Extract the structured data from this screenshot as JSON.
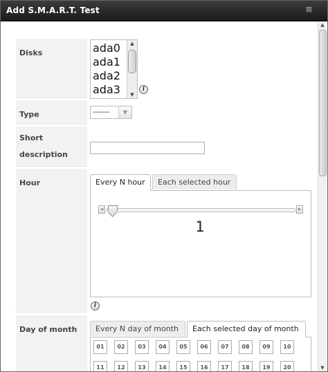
{
  "dialog": {
    "title": "Add S.M.A.R.T. Test",
    "close_symbol": "⊠"
  },
  "form": {
    "disks": {
      "label": "Disks",
      "options": [
        "ada0",
        "ada1",
        "ada2",
        "ada3"
      ]
    },
    "type": {
      "label": "Type",
      "selected": "---------"
    },
    "short_description": {
      "label_line1": "Short",
      "label_line2": "description",
      "value": ""
    },
    "hour": {
      "label": "Hour",
      "tabs": [
        "Every N hour",
        "Each selected hour"
      ],
      "active_tab": 0,
      "slider_value": "1"
    },
    "day_of_month": {
      "label": "Day of month",
      "tabs": [
        "Every N day of month",
        "Each selected day of month"
      ],
      "active_tab": 1,
      "days": [
        "01",
        "02",
        "03",
        "04",
        "05",
        "06",
        "07",
        "08",
        "09",
        "10",
        "11",
        "12",
        "13",
        "14",
        "15",
        "16",
        "17",
        "18",
        "19",
        "20"
      ]
    }
  },
  "icons": {
    "help": "info-icon",
    "close": "close-icon"
  },
  "colors": {
    "titlebar": "#2a2a2a",
    "label_bg": "#f2f2f2",
    "accent_arrow": "#7a9ac0"
  }
}
